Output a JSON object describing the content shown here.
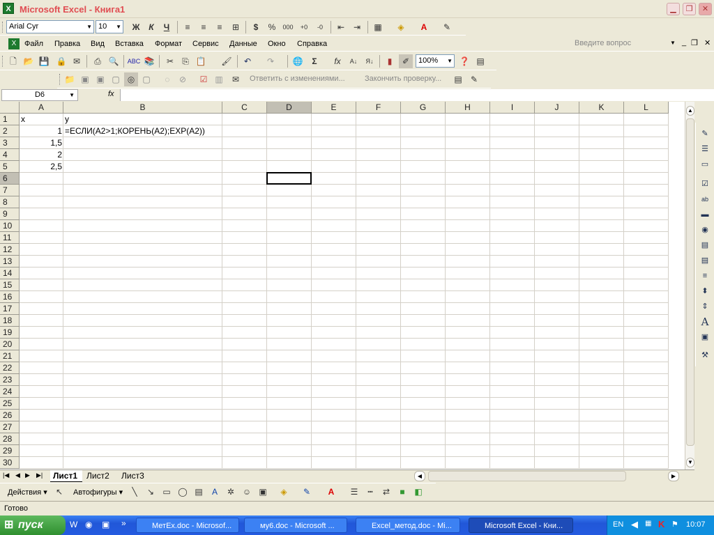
{
  "window": {
    "title": "Microsoft Excel - Книга1"
  },
  "format_toolbar": {
    "font": "Arial Cyr",
    "size": "10",
    "bold": "Ж",
    "italic": "К",
    "underline": "Ч",
    "currency": "$",
    "percent": "%",
    "thousands": "000"
  },
  "menu": {
    "items": [
      "Файл",
      "Правка",
      "Вид",
      "Вставка",
      "Формат",
      "Сервис",
      "Данные",
      "Окно",
      "Справка"
    ],
    "help_placeholder": "Введите вопрос"
  },
  "standard_toolbar": {
    "zoom": "100%",
    "sigma": "Σ",
    "fx": "fx"
  },
  "review_toolbar": {
    "reply": "Ответить с изменениями...",
    "end_review": "Закончить проверку..."
  },
  "formula_bar": {
    "name_box": "D6",
    "fx_label": "fx",
    "content": ""
  },
  "columns": [
    "A",
    "B",
    "C",
    "D",
    "E",
    "F",
    "G",
    "H",
    "I",
    "J",
    "K",
    "L"
  ],
  "rows": [
    "1",
    "2",
    "3",
    "4",
    "5",
    "6",
    "7",
    "8",
    "9",
    "10",
    "11",
    "12",
    "13",
    "14",
    "15",
    "16",
    "17",
    "18",
    "19",
    "20",
    "21",
    "22",
    "23",
    "24",
    "25",
    "26",
    "27",
    "28",
    "29",
    "30"
  ],
  "cells": {
    "A1": "x",
    "B1": "y",
    "A2": "1",
    "B2": "=ЕСЛИ(A2>1;КОРЕНЬ(A2);EXP(A2))",
    "A3": "1,5",
    "A4": "2",
    "A5": "2,5"
  },
  "active_cell": "D6",
  "sheets": {
    "tabs": [
      "Лист1",
      "Лист2",
      "Лист3"
    ],
    "active": "Лист1"
  },
  "drawing_toolbar": {
    "actions": "Действия",
    "autoshapes": "Автофигуры"
  },
  "status": {
    "text": "Готово"
  },
  "taskbar": {
    "start": "пуск",
    "tasks": [
      "МетЕх.doc - Microsof...",
      "му6.doc - Microsoft ...",
      "Excel_метод.doc - Mi...",
      "Microsoft Excel - Кни..."
    ],
    "language": "EN",
    "clock": "10:07"
  }
}
